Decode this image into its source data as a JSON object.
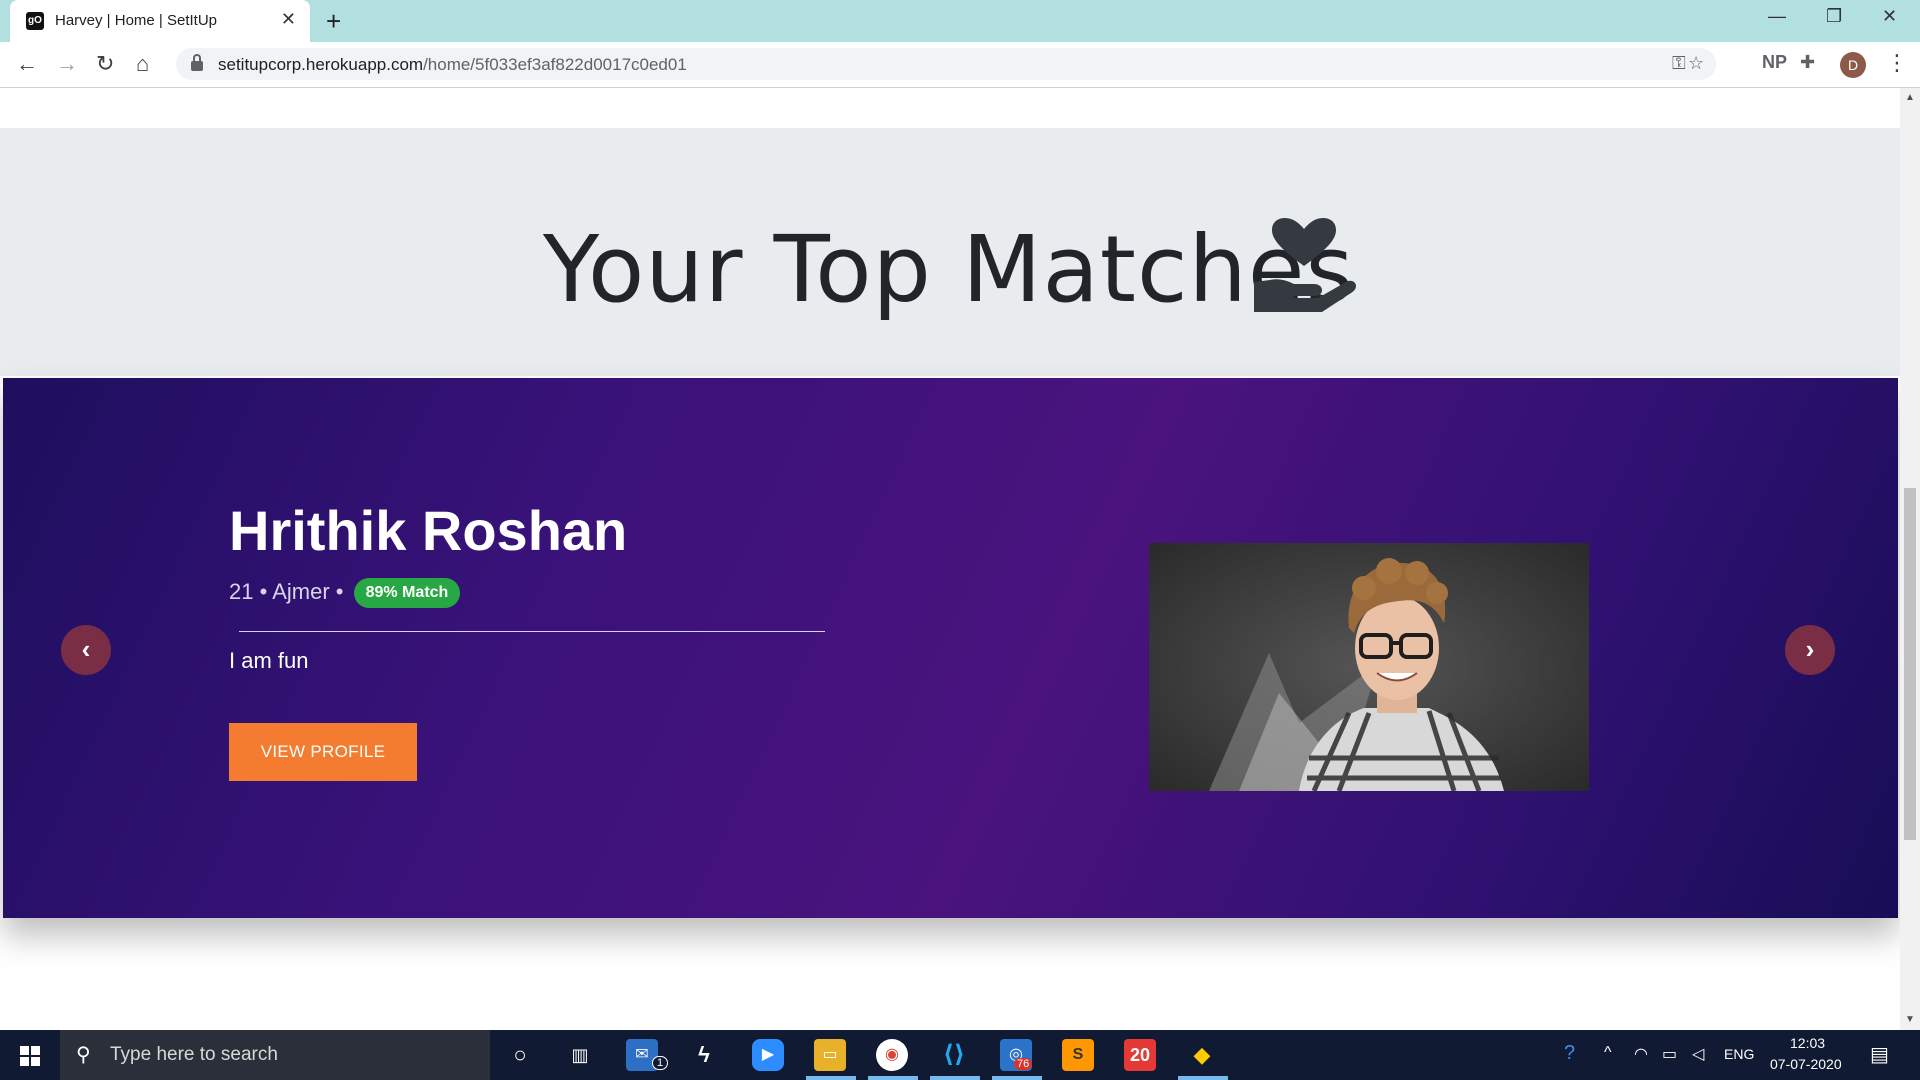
{
  "browser": {
    "tab_title": "Harvey | Home | SetItUp",
    "tab_favicon": "gO",
    "url_host": "setitupcorp.herokuapp.com",
    "url_path": "/home/5f033ef3af822d0017c0ed01",
    "profile_initial": "D",
    "extension_label": "NP"
  },
  "page": {
    "section_title": "Your Top Matches",
    "section_icon": "hand-holding-heart-icon"
  },
  "match": {
    "name": "Hrithik Roshan",
    "age": "21",
    "city": "Ajmer",
    "separator": "•",
    "match_badge": "89% Match",
    "bio": "I am fun",
    "view_profile_label": "VIEW PROFILE"
  },
  "taskbar": {
    "search_placeholder": "Type here to search",
    "mail_badge": "1",
    "app_badge": "76",
    "app_tile_label": "20",
    "language": "ENG",
    "time": "12:03",
    "date": "07-07-2020"
  },
  "colors": {
    "accent_orange": "#f47c30",
    "match_green": "#28a745",
    "carousel_purple": "#4a137e"
  }
}
